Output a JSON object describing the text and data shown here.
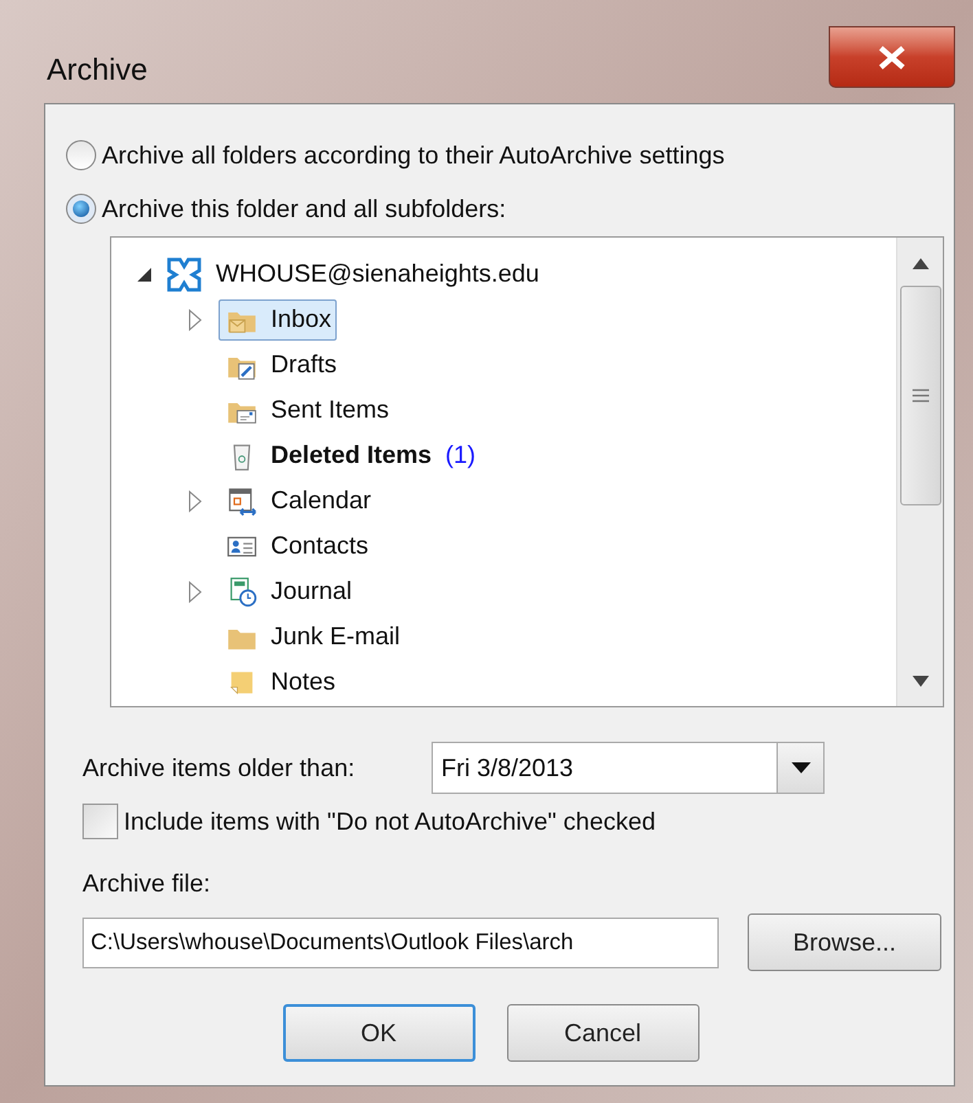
{
  "window": {
    "title": "Archive"
  },
  "options": [
    {
      "label": "Archive all folders according to their AutoArchive settings",
      "selected": false
    },
    {
      "label": "Archive this folder and all subfolders:",
      "selected": true
    }
  ],
  "folder_tree": {
    "root": {
      "label": "WHOUSE@sienaheights.edu",
      "kind": "account",
      "expanded": true,
      "children": [
        {
          "label": "Inbox",
          "kind": "inbox",
          "expandable": true,
          "selected": true,
          "bold": false
        },
        {
          "label": "Drafts",
          "kind": "drafts",
          "expandable": false,
          "selected": false,
          "bold": false
        },
        {
          "label": "Sent Items",
          "kind": "sent",
          "expandable": false,
          "selected": false,
          "bold": false
        },
        {
          "label": "Deleted Items",
          "kind": "deleted",
          "expandable": false,
          "selected": false,
          "bold": true,
          "count": "(1)"
        },
        {
          "label": "Calendar",
          "kind": "calendar",
          "expandable": true,
          "selected": false,
          "bold": false
        },
        {
          "label": "Contacts",
          "kind": "contacts",
          "expandable": false,
          "selected": false,
          "bold": false
        },
        {
          "label": "Journal",
          "kind": "journal",
          "expandable": true,
          "selected": false,
          "bold": false
        },
        {
          "label": "Junk E-mail",
          "kind": "folder",
          "expandable": false,
          "selected": false,
          "bold": false
        },
        {
          "label": "Notes",
          "kind": "notes",
          "expandable": false,
          "selected": false,
          "bold": false
        }
      ]
    }
  },
  "older_than": {
    "label": "Archive items older than:",
    "value": "Fri 3/8/2013"
  },
  "include_checkbox": {
    "label": "Include items with \"Do not AutoArchive\" checked",
    "checked": false
  },
  "archive_file": {
    "label": "Archive file:",
    "value": "C:\\Users\\whouse\\Documents\\Outlook Files\\arch",
    "browse": "Browse..."
  },
  "buttons": [
    {
      "label": "OK",
      "default": true
    },
    {
      "label": "Cancel",
      "default": false
    }
  ]
}
